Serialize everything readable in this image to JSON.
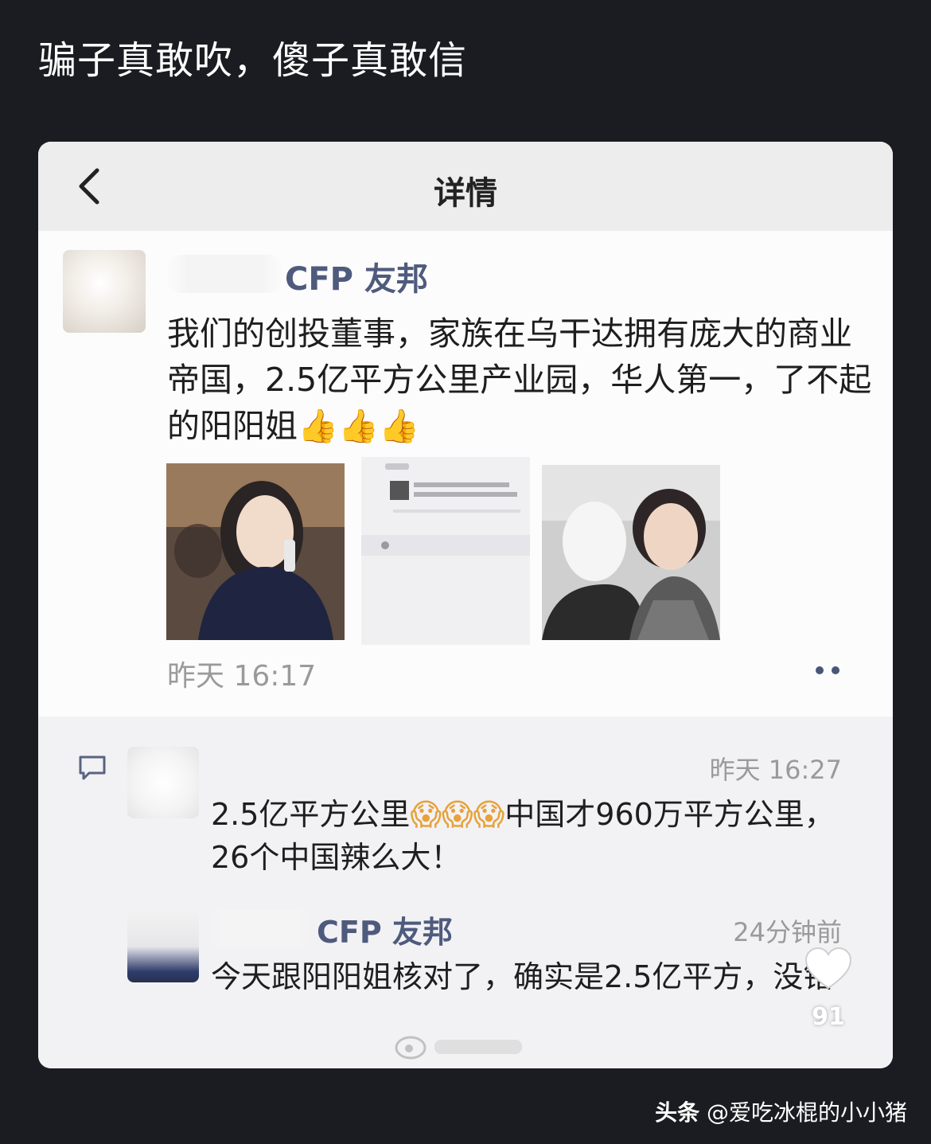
{
  "headline": "骗子真敢吹，傻子真敢信",
  "detail_screen": {
    "title": "详情",
    "post": {
      "author": "CFP 友邦",
      "text": "我们的创投董事，家族在乌干达拥有庞大的商业帝国，2.5亿平方公里产业园，华人第一，了不起的阳阳姐",
      "emoji": "👍👍👍",
      "time": "昨天 16:17"
    },
    "comments": [
      {
        "time": "昨天 16:27",
        "text_before": "2.5亿平方公里",
        "emoji": "😱😱😱",
        "text_after": "中国才960万平方公里，26个中国辣么大！"
      },
      {
        "author": "CFP 友邦",
        "time": "24分钟前",
        "text": "今天跟阳阳姐核对了，确实是2.5亿平方，没错"
      }
    ],
    "likes": "91"
  },
  "footer": {
    "brand": "头条",
    "user": "@爱吃冰棍的小小猪"
  }
}
